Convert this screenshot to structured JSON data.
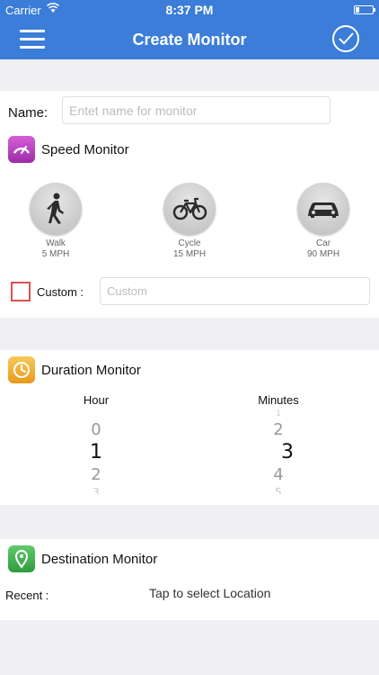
{
  "status_bar": {
    "carrier": "Carrier",
    "time": "8:37 PM"
  },
  "nav": {
    "title": "Create Monitor",
    "menu_icon": "hamburger-menu-icon",
    "done_icon": "checkmark-circle-icon"
  },
  "name_field": {
    "label": "Name:",
    "placeholder": "Entet name for monitor"
  },
  "speed_monitor": {
    "title": "Speed Monitor",
    "icon": "speedometer-icon",
    "modes": [
      {
        "label": "Walk",
        "speed": "5 MPH",
        "icon": "walking-person-icon"
      },
      {
        "label": "Cycle",
        "speed": "15 MPH",
        "icon": "bicycle-icon"
      },
      {
        "label": "Car",
        "speed": "90 MPH",
        "icon": "car-icon"
      }
    ],
    "custom_label": "Custom :",
    "custom_placeholder": "Custom",
    "custom_checked": false
  },
  "duration_monitor": {
    "title": "Duration Monitor",
    "icon": "clock-icon",
    "hour": {
      "label": "Hour",
      "above_faint": "",
      "above": "0",
      "selected": "1",
      "below": "2",
      "below_faint": "3"
    },
    "minutes": {
      "label": "Minutes",
      "above_faint": "1",
      "above": "2",
      "selected": "3",
      "below": "4",
      "below_faint": "5"
    }
  },
  "destination_monitor": {
    "title": "Destination Monitor",
    "icon": "location-pin-icon",
    "recent_label": "Recent :",
    "location_placeholder": "Tap to select Location"
  },
  "colors": {
    "nav_blue": "#3b7dd8",
    "background": "#efeff4",
    "checkbox_red": "#d9534f"
  }
}
